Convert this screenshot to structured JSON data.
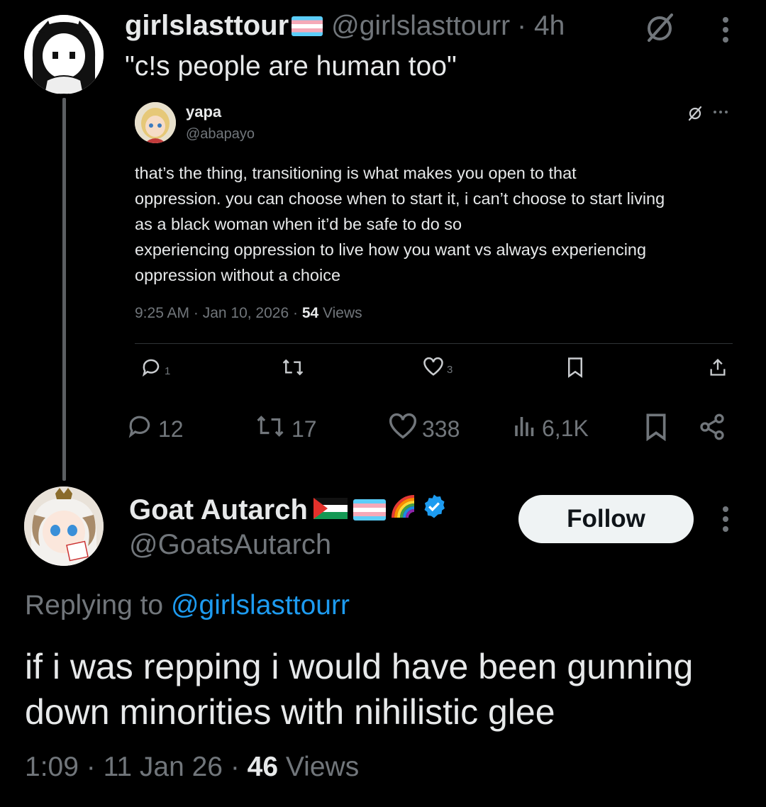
{
  "parent_tweet": {
    "display_name": "girlslasttour",
    "handle": "@girlslasttourr",
    "time": "· 4h",
    "text": "\"c!s people are human too\"",
    "icons": {
      "flag": "trans-flag-icon",
      "grok": "slash-circle-icon",
      "more": "more-vertical-icon"
    }
  },
  "quoted_tweet": {
    "display_name": "yapa",
    "handle": "@abapayo",
    "lines": [
      "that’s the thing, transitioning is what makes you open to that",
      "oppression. you can choose when to start it, i can’t choose to start living",
      "as a black woman when it’d be safe to do so",
      "experiencing oppression to live how you want vs always experiencing",
      "oppression without a choice"
    ],
    "meta_time": "9:25 AM · Jan 10, 2026 · ",
    "meta_views_count": "54",
    "meta_views_label": " Views",
    "actions": {
      "replies": "1",
      "retweets": "",
      "likes": "3"
    }
  },
  "parent_actions": {
    "replies": "12",
    "retweets": "17",
    "likes": "338",
    "views": "6,1K"
  },
  "reply_tweet": {
    "display_name": "Goat Autarch",
    "handle": "@GoatsAutarch",
    "follow_label": "Follow",
    "replying_prefix": "Replying to ",
    "replying_handle": "@girlslasttourr",
    "text": "if i was repping i would have been gunning down minorities with nihilistic glee",
    "meta_time": "1:09 · 11 Jan 26 · ",
    "meta_views_count": "46",
    "meta_views_label": " Views",
    "icons": [
      "palestine-flag-icon",
      "trans-flag-icon",
      "rainbow-icon",
      "verified-badge-icon"
    ]
  },
  "colors": {
    "background": "#000000",
    "text": "#e7e9ea",
    "muted": "#71767b",
    "link": "#1d9bf0",
    "verified": "#1d9bf0"
  }
}
